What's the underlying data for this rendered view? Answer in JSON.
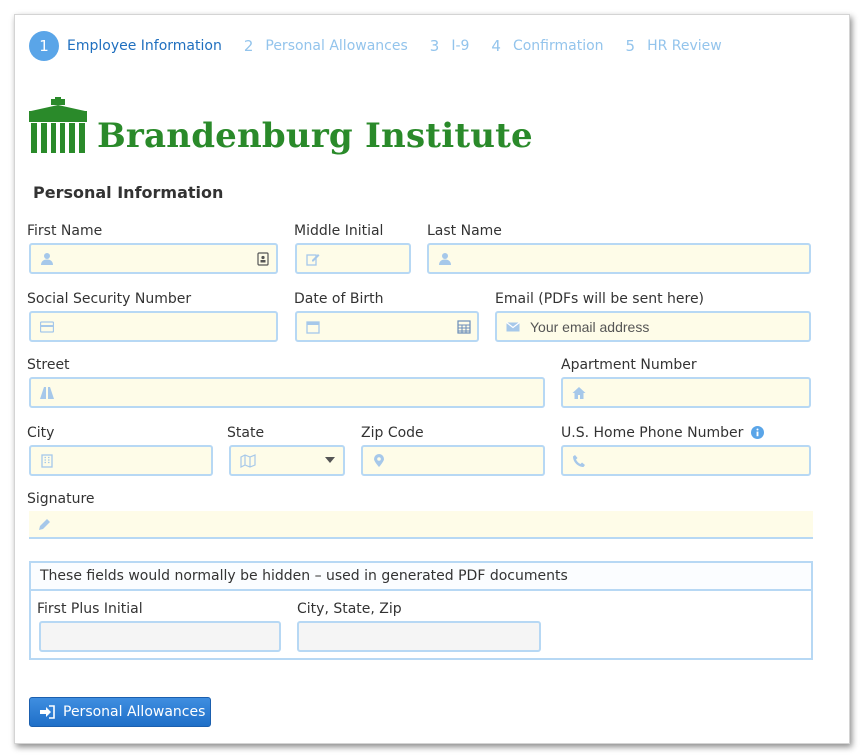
{
  "steps": [
    {
      "num": "1",
      "label": "Employee Information"
    },
    {
      "num": "2",
      "label": "Personal Allowances"
    },
    {
      "num": "3",
      "label": "I-9"
    },
    {
      "num": "4",
      "label": "Confirmation"
    },
    {
      "num": "5",
      "label": "HR Review"
    }
  ],
  "logo": {
    "text": "Brandenburg Institute",
    "color": "#2a8a2a"
  },
  "section_title": "Personal Information",
  "fields": {
    "first_name": "First Name",
    "middle_initial": "Middle Initial",
    "last_name": "Last Name",
    "ssn": "Social Security Number",
    "dob": "Date of Birth",
    "email": "Email (PDFs will be sent here)",
    "email_placeholder": "Your email address",
    "street": "Street",
    "apartment": "Apartment Number",
    "city": "City",
    "state": "State",
    "zip": "Zip Code",
    "phone": "U.S. Home Phone Number",
    "signature": "Signature"
  },
  "hidden_section": {
    "title": "These fields would normally be hidden – used in generated PDF documents",
    "first_plus_initial": "First Plus Initial",
    "city_state_zip": "City, State, Zip"
  },
  "next_button": {
    "label": "Personal Allowances"
  },
  "colors": {
    "accent": "#5aa5e8",
    "input_bg": "#fefce8",
    "input_border": "#b7d8f4",
    "icon": "#a6c8ea"
  }
}
